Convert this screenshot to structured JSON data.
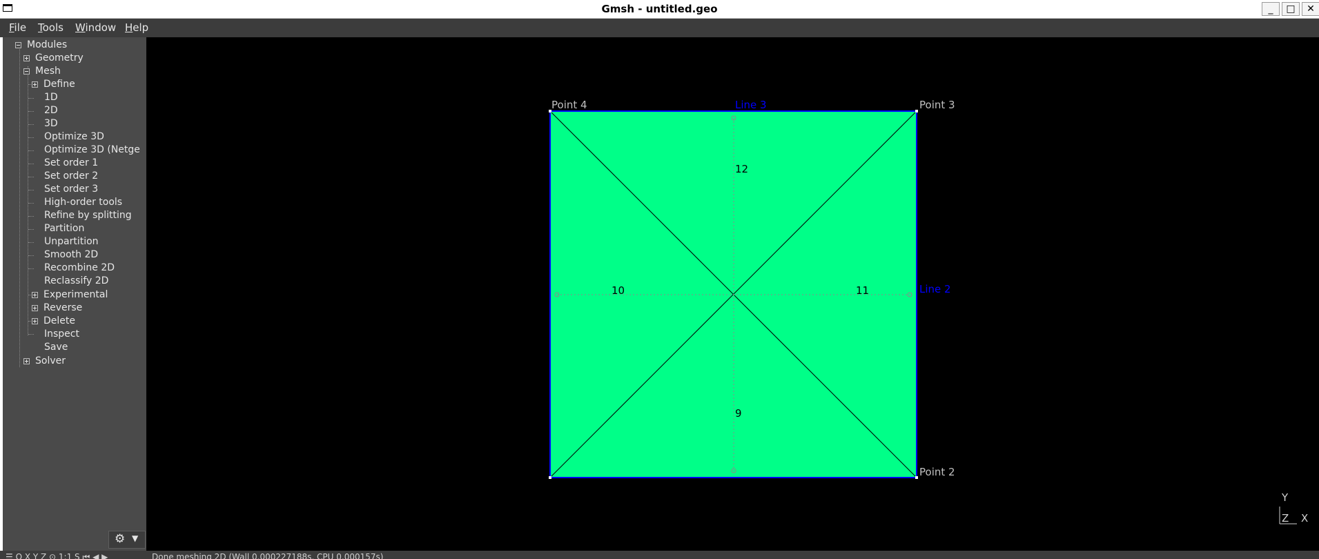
{
  "window": {
    "title": "Gmsh - untitled.geo",
    "minimize_glyph": "_",
    "maximize_glyph": "□",
    "close_glyph": "✕"
  },
  "menu": {
    "file": {
      "accel": "F",
      "rest": "ile"
    },
    "tools": {
      "accel": "T",
      "rest": "ools"
    },
    "window": {
      "accel": "W",
      "rest": "indow"
    },
    "help": {
      "accel": "H",
      "rest": "elp"
    }
  },
  "tree": {
    "modules": "Modules",
    "geometry": "Geometry",
    "mesh": "Mesh",
    "define": "Define",
    "mesh_1d": "1D",
    "mesh_2d": "2D",
    "mesh_3d": "3D",
    "optimize_3d": "Optimize 3D",
    "optimize_3d_netgen": "Optimize 3D (Netge",
    "set_order_1": "Set order 1",
    "set_order_2": "Set order 2",
    "set_order_3": "Set order 3",
    "high_order_tools": "High-order tools",
    "refine_by_splitting": "Refine by splitting",
    "partition": "Partition",
    "unpartition": "Unpartition",
    "smooth_2d": "Smooth 2D",
    "recombine_2d": "Recombine 2D",
    "reclassify_2d": "Reclassify 2D",
    "experimental": "Experimental",
    "reverse": "Reverse",
    "delete": "Delete",
    "inspect": "Inspect",
    "save": "Save",
    "solver": "Solver"
  },
  "settings_button": {
    "gear": "⚙",
    "caret": "▼",
    "icon": "gear-icon"
  },
  "viewport": {
    "point_4": "Point 4",
    "point_3": "Point 3",
    "point_2": "Point 2",
    "line_3": "Line 3",
    "line_2": "Line 2",
    "elem_12": "12",
    "elem_10": "10",
    "elem_11": "11",
    "elem_9": "9",
    "axis_y": "Y",
    "axis_z": "Z",
    "axis_x": "X",
    "colors": {
      "surface": "#00ff88",
      "boundary": "#0000ff",
      "mesh_lines": "#000000",
      "point_labels": "#c0c0c0",
      "line_labels": "#0000ff"
    }
  },
  "status": {
    "toolbar": "☰ O X Y Z ⊙ 1:1 S   ⏮ ◀ ▶",
    "message": "Done meshing 2D (Wall 0.000227188s, CPU 0.000157s)"
  }
}
